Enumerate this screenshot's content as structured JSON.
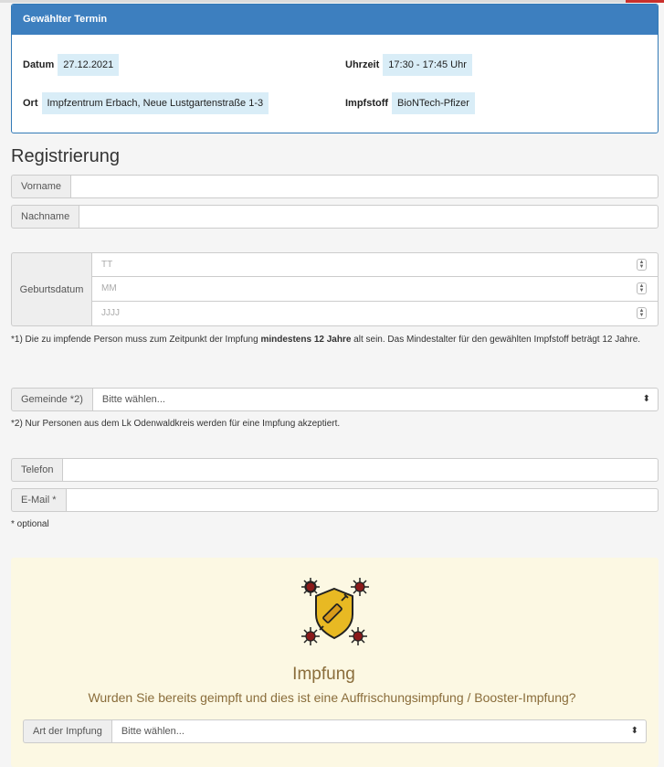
{
  "termin": {
    "header": "Gewählter Termin",
    "datum_label": "Datum",
    "datum_value": "27.12.2021",
    "uhrzeit_label": "Uhrzeit",
    "uhrzeit_value": "17:30 - 17:45 Uhr",
    "ort_label": "Ort",
    "ort_value": "Impfzentrum Erbach, Neue Lustgartenstraße 1-3",
    "impfstoff_label": "Impfstoff",
    "impfstoff_value": "BioNTech-Pfizer"
  },
  "form": {
    "title": "Registrierung",
    "vorname_label": "Vorname",
    "vorname_value": "",
    "nachname_label": "Nachname",
    "nachname_value": "",
    "geburtsdatum_label": "Geburtsdatum",
    "tag_placeholder": "TT",
    "monat_placeholder": "MM",
    "jahr_placeholder": "JJJJ",
    "note1_prefix": "*1) Die zu impfende Person muss zum Zeitpunkt der Impfung ",
    "note1_bold": "mindestens 12 Jahre",
    "note1_suffix": " alt sein. Das Mindestalter für den gewählten Impfstoff beträgt 12 Jahre.",
    "gemeinde_label": "Gemeinde *2)",
    "gemeinde_value": "Bitte wählen...",
    "note2": "*2) Nur Personen aus dem Lk Odenwaldkreis werden für eine Impfung akzeptiert.",
    "telefon_label": "Telefon",
    "telefon_value": "",
    "email_label": "E-Mail *",
    "email_value": "",
    "optional_note": "* optional"
  },
  "impfung": {
    "title": "Impfung",
    "question": "Wurden Sie bereits geimpft und dies ist eine Auffrischungsimpfung / Booster-Impfung?",
    "art_label": "Art der Impfung",
    "art_value": "Bitte wählen...",
    "icon": "vaccine-shield-icon"
  },
  "colors": {
    "panel_header": "#3d7fbf",
    "info_badge": "#d9edf7",
    "card_bg": "#fcf8e3",
    "card_text": "#8a6d3b"
  }
}
